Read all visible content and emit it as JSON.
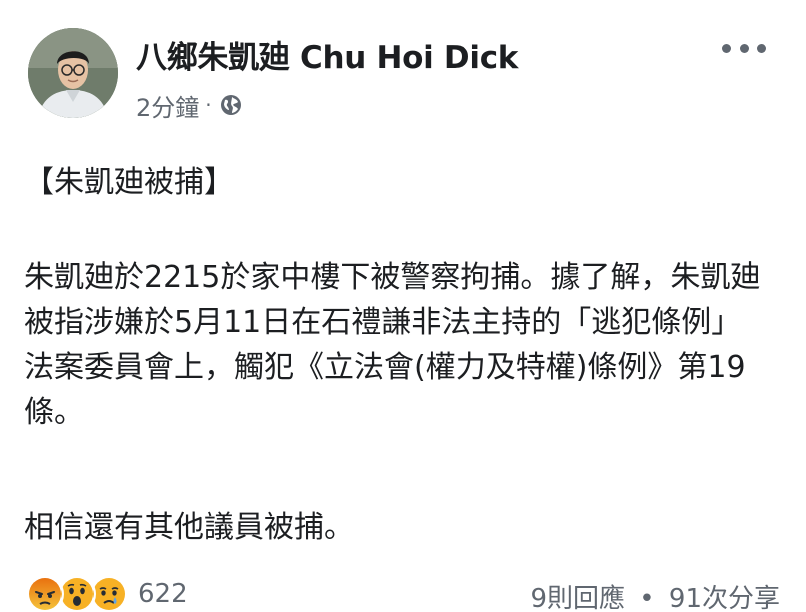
{
  "post": {
    "author": {
      "name": "八鄉朱凱廸 Chu Hoi Dick"
    },
    "timestamp": "2分鐘",
    "meta_separator": "·",
    "privacy_icon": "globe-icon",
    "more_icon": "more-options-icon",
    "text": {
      "title": "【朱凱廸被捕】",
      "main": "朱凱廸於2215於家中樓下被警察拘捕。據了解，朱凱廸被指涉嫌於5月11日在石禮謙非法主持的「逃犯條例」法案委員會上，觸犯《立法會(權力及特權)條例》第19條。",
      "end": "相信還有其他議員被捕。"
    },
    "reactions": {
      "icons": [
        "angry-emoji-icon",
        "wow-emoji-icon",
        "sad-emoji-icon"
      ],
      "count": "622"
    },
    "stats": {
      "comments": "9則回應",
      "separator": "•",
      "shares": "91次分享"
    }
  },
  "colors": {
    "text_primary": "#1c1e21",
    "text_secondary": "#606770",
    "angry": "#e9710f",
    "wow_sad": "#f7b125"
  }
}
